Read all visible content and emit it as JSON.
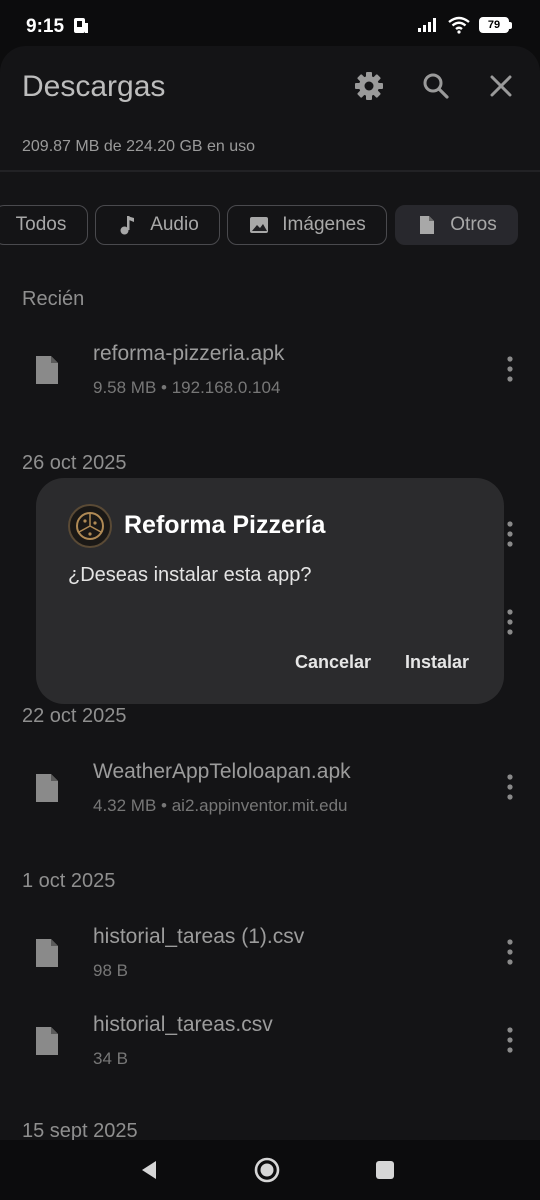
{
  "status_bar": {
    "time": "9:15",
    "battery": "79"
  },
  "header": {
    "title": "Descargas",
    "storage": "209.87 MB de 224.20 GB en uso",
    "icons": [
      "gear-icon",
      "search-icon",
      "close-icon"
    ]
  },
  "filters": {
    "chips": [
      {
        "label": "Todos"
      },
      {
        "label": "Audio",
        "icon": "music-note-icon"
      },
      {
        "label": "Imágenes",
        "icon": "image-icon"
      },
      {
        "label": "Otros",
        "icon": "file-icon"
      }
    ],
    "selected": "Otros"
  },
  "sections": [
    {
      "label": "Recién",
      "items": [
        {
          "name": "reforma-pizzeria.apk",
          "meta": "9.58 MB • 192.168.0.104"
        }
      ]
    },
    {
      "label": "26 oct 2025",
      "items": []
    },
    {
      "label": "22 oct 2025",
      "items": [
        {
          "name": "WeatherAppTeloloapan.apk",
          "meta": "4.32 MB • ai2.appinventor.mit.edu"
        }
      ]
    },
    {
      "label": "1 oct 2025",
      "items": [
        {
          "name": "historial_tareas (1).csv",
          "meta": "98 B"
        },
        {
          "name": "historial_tareas.csv",
          "meta": "34 B"
        }
      ]
    },
    {
      "label": "15 sept 2025",
      "items": []
    }
  ],
  "dialog": {
    "app_name": "Reforma Pizzería",
    "message": "¿Deseas instalar esta app?",
    "cancel_label": "Cancelar",
    "install_label": "Instalar"
  },
  "nav": {
    "icons": [
      "back-icon",
      "home-icon",
      "recents-icon"
    ]
  },
  "colors": {
    "background": "#141416",
    "dialog": "#2b2b2d",
    "chip_active": "#28282d"
  }
}
